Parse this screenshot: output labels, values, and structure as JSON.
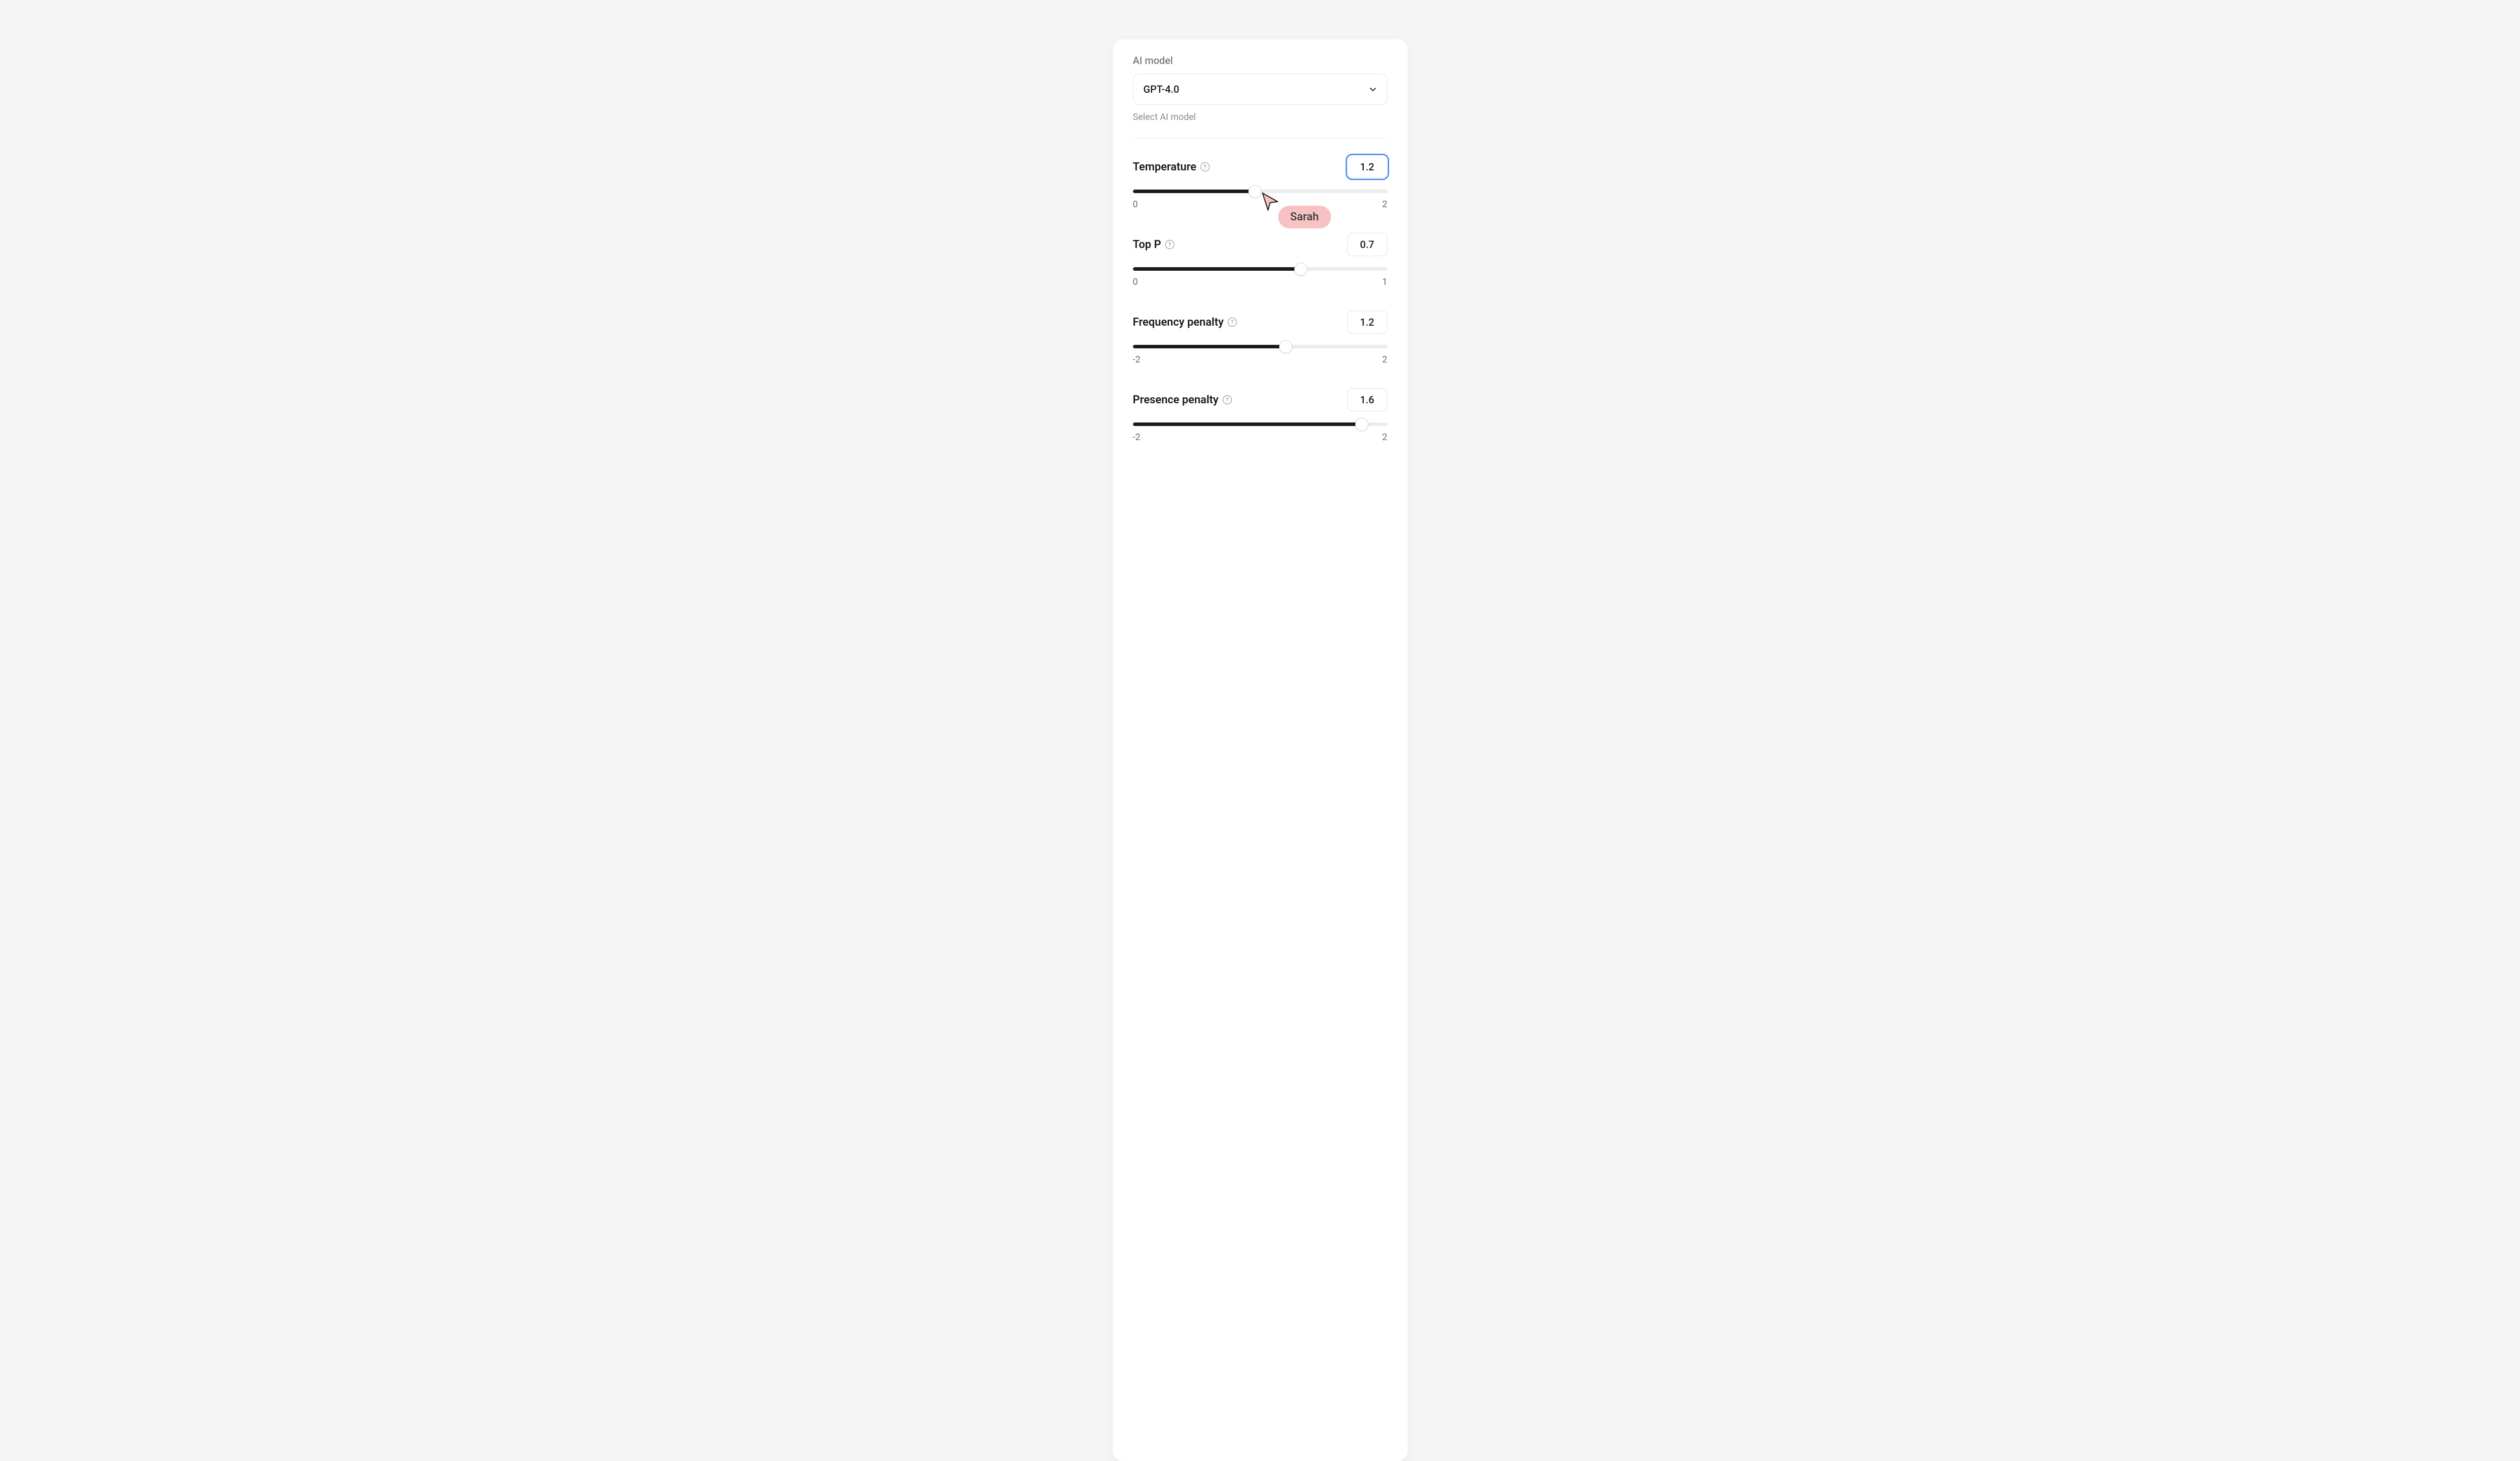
{
  "model": {
    "label": "AI model",
    "selected": "GPT-4.0",
    "helper": "Select AI model"
  },
  "cursor": {
    "user": "Sarah",
    "color": "#f7c2c2"
  },
  "params": [
    {
      "key": "temperature",
      "label": "Temperature",
      "value": "1.2",
      "min": "0",
      "max": "2",
      "fillPercent": 48,
      "focused": true,
      "showCursor": true
    },
    {
      "key": "top_p",
      "label": "Top P",
      "value": "0.7",
      "min": "0",
      "max": "1",
      "fillPercent": 66,
      "focused": false,
      "showCursor": false
    },
    {
      "key": "frequency_penalty",
      "label": "Frequency penalty",
      "value": "1.2",
      "min": "-2",
      "max": "2",
      "fillPercent": 60,
      "focused": false,
      "showCursor": false
    },
    {
      "key": "presence_penalty",
      "label": "Presence penalty",
      "value": "1.6",
      "min": "-2",
      "max": "2",
      "fillPercent": 90,
      "focused": false,
      "showCursor": false
    }
  ]
}
